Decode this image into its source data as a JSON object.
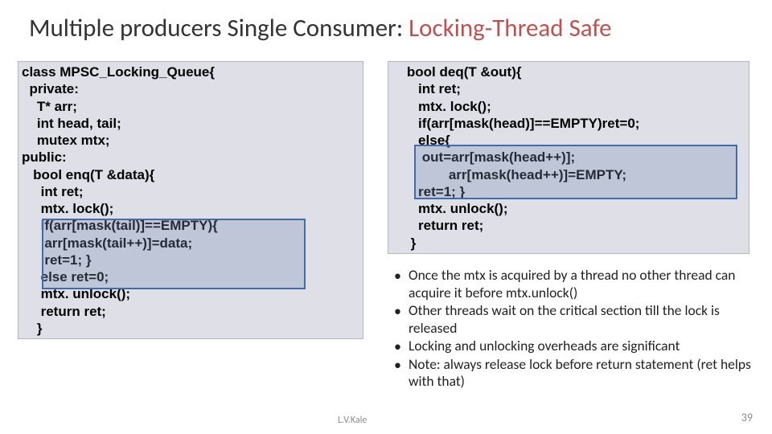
{
  "title": {
    "plain": "Multiple producers Single Consumer: ",
    "accent": "Locking-Thread Safe"
  },
  "code_left": "class MPSC_Locking_Queue{\n  private:\n    T* arr;\n    int head, tail;\n    mutex mtx;\npublic:\n   bool enq(T &data){\n     int ret;\n     mtx. lock();\n     if(arr[mask(tail)]==EMPTY){\n      arr[mask(tail++)]=data;\n      ret=1; }\n     else ret=0;\n     mtx. unlock();\n     return ret;\n    }",
  "code_right": "    bool deq(T &out){\n       int ret;\n       mtx. lock();\n       if(arr[mask(head)]==EMPTY)ret=0;\n       else{\n        out=arr[mask(head++)];\n               arr[mask(head++)]=EMPTY;\n       ret=1; }\n       mtx. unlock();\n       return ret;\n     }",
  "notes": [
    "Once the mtx is acquired by a thread no other thread can acquire it before mtx.unlock()",
    "Other threads wait on the critical section till the lock is released",
    "Locking and unlocking overheads are significant",
    "Note: always release lock before return statement (ret helps with that)"
  ],
  "footer": {
    "author": "L.V.Kale",
    "page": "39"
  }
}
